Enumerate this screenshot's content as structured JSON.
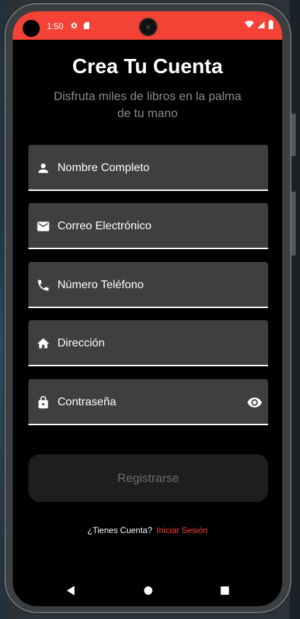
{
  "status_bar": {
    "time": "1:50",
    "color": "#f44336",
    "icons_left": [
      "settings-icon",
      "sd-card-icon"
    ],
    "icons_right": [
      "wifi-icon",
      "signal-icon",
      "battery-icon"
    ]
  },
  "header": {
    "title": "Crea Tu Cuenta",
    "subtitle": "Disfruta miles de libros en la palma de tu mano"
  },
  "form": {
    "fields": [
      {
        "label": "Nombre Completo",
        "icon": "person-icon"
      },
      {
        "label": "Correo Electrónico",
        "icon": "email-icon"
      },
      {
        "label": "Número Teléfono",
        "icon": "phone-icon"
      },
      {
        "label": "Dirección",
        "icon": "home-icon"
      },
      {
        "label": "Contraseña",
        "icon": "lock-icon",
        "trailing_icon": "eye-icon"
      }
    ],
    "submit_label": "Registrarse"
  },
  "footer": {
    "question": "¿Tienes Cuenta?",
    "link": "Iniciar Sesión",
    "link_color": "#f44336"
  },
  "nav_bar": [
    "back-icon",
    "home-circle-icon",
    "recents-icon"
  ]
}
